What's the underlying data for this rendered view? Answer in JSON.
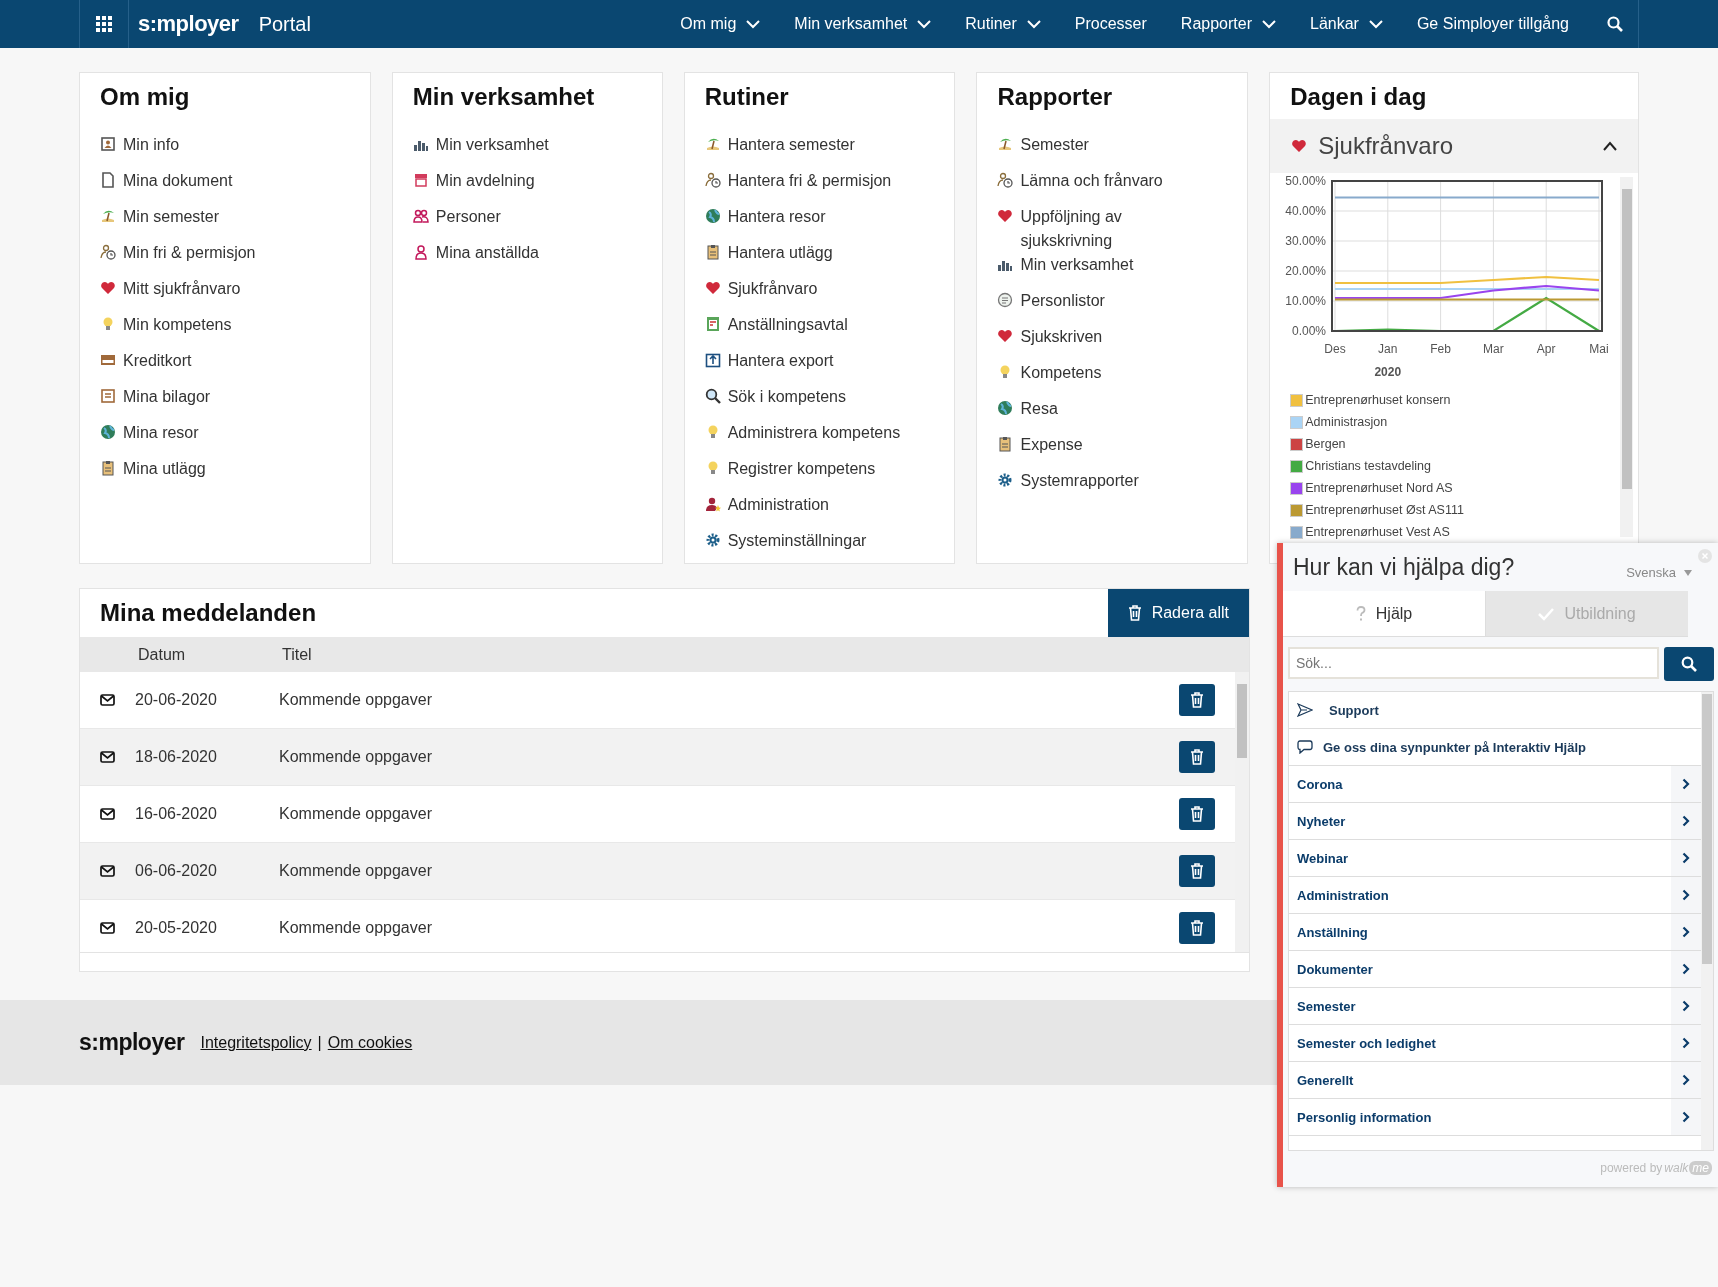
{
  "topbar": {
    "logo": "s:mployer",
    "app": "Portal",
    "menu": [
      {
        "label": "Om mig",
        "dropdown": true
      },
      {
        "label": "Min verksamhet",
        "dropdown": true
      },
      {
        "label": "Rutiner",
        "dropdown": true
      },
      {
        "label": "Processer",
        "dropdown": false
      },
      {
        "label": "Rapporter",
        "dropdown": true
      },
      {
        "label": "Länkar",
        "dropdown": true
      },
      {
        "label": "Ge Simployer tillgång",
        "dropdown": false
      }
    ]
  },
  "cards": [
    {
      "title": "Om mig",
      "items": [
        "Min info",
        "Mina dokument",
        "Min semester",
        "Min fri & permisjon",
        "Mitt sjukfrånvaro",
        "Min kompetens",
        "Kreditkort",
        "Mina bilagor",
        "Mina resor",
        "Mina utlägg"
      ]
    },
    {
      "title": "Min verksamhet",
      "items": [
        "Min verksamhet",
        "Min avdelning",
        "Personer",
        "Mina anställda"
      ]
    },
    {
      "title": "Rutiner",
      "items": [
        "Hantera semester",
        "Hantera fri & permisjon",
        "Hantera resor",
        "Hantera utlägg",
        "Sjukfrånvaro",
        "Anställningsavtal",
        "Hantera export",
        "Sök i kompetens",
        "Administrera kompetens",
        "Registrer kompetens",
        "Administration",
        "Systeminställningar"
      ]
    },
    {
      "title": "Rapporter",
      "items": [
        "Semester",
        "Lämna och frånvaro",
        "Uppföljning av sjukskrivning",
        "Min verksamhet",
        "Personlistor",
        "Sjukskriven",
        "Kompetens",
        "Resa",
        "Expense",
        "Systemrapporter"
      ]
    }
  ],
  "today": {
    "title": "Dagen i dag",
    "section": {
      "label": "Sjukfrånvaro",
      "expanded": true
    },
    "chart_data": {
      "type": "line",
      "grid": true,
      "legend": true,
      "xlabel": "2020",
      "categories": [
        "Des",
        "Jan",
        "Feb",
        "Mar",
        "Apr",
        "Mai"
      ],
      "ylim": [
        0,
        50
      ],
      "yticks": [
        {
          "value": 0,
          "label": "0.00%"
        },
        {
          "value": 10,
          "label": "10.00%"
        },
        {
          "value": 20,
          "label": "20.00%"
        },
        {
          "value": 30,
          "label": "30.00%"
        },
        {
          "value": 40,
          "label": "40.00%"
        },
        {
          "value": 50,
          "label": "50.00%"
        }
      ],
      "series": [
        {
          "name": "Entreprenørhuset konsern",
          "color": "#f0c040",
          "values": [
            16,
            16,
            16,
            17,
            18,
            17
          ]
        },
        {
          "name": "Administrasjon",
          "color": "#aad4f5",
          "values": [
            14,
            14,
            14,
            14,
            14,
            14
          ]
        },
        {
          "name": "Bergen",
          "color": "#cc4444",
          "values": [
            null,
            null,
            null,
            null,
            null,
            null
          ]
        },
        {
          "name": "Christians testavdeling",
          "color": "#44aa44",
          "values": [
            0,
            0.5,
            0,
            0,
            11,
            0
          ]
        },
        {
          "name": "Entreprenørhuset Nord AS",
          "color": "#9944ee",
          "values": [
            11,
            11,
            11,
            13.5,
            15,
            13.5
          ]
        },
        {
          "name": "Entreprenørhuset Øst AS111",
          "color": "#bb9933",
          "values": [
            10.5,
            10.5,
            10.5,
            10.5,
            10.5,
            10.5
          ]
        },
        {
          "name": "Entreprenørhuset Vest AS",
          "color": "#88aacc",
          "values": [
            44.5,
            44.5,
            44.5,
            44.5,
            44.5,
            44.5
          ]
        }
      ]
    }
  },
  "messages": {
    "title": "Mina meddelanden",
    "delete_all": "Radera allt",
    "columns": [
      "Datum",
      "Titel"
    ],
    "rows": [
      {
        "date": "20-06-2020",
        "title": "Kommende oppgaver"
      },
      {
        "date": "18-06-2020",
        "title": "Kommende oppgaver"
      },
      {
        "date": "16-06-2020",
        "title": "Kommende oppgaver"
      },
      {
        "date": "06-06-2020",
        "title": "Kommende oppgaver"
      },
      {
        "date": "20-05-2020",
        "title": "Kommende oppgaver"
      }
    ]
  },
  "footer": {
    "logo": "s:mployer",
    "links": [
      "Integritetspolicy",
      "Om cookies"
    ],
    "separator": "|"
  },
  "help": {
    "title": "Hur kan vi hjälpa dig?",
    "language": "Svenska",
    "tabs": [
      {
        "label": "Hjälp",
        "selected": true
      },
      {
        "label": "Utbildning",
        "selected": false
      }
    ],
    "search": {
      "placeholder": "Sök..."
    },
    "items": [
      {
        "kind": "link",
        "label": "Support"
      },
      {
        "kind": "feedback",
        "label": "Ge oss dina synpunkter på Interaktiv Hjälp"
      },
      {
        "kind": "category",
        "label": "Corona"
      },
      {
        "kind": "category",
        "label": "Nyheter"
      },
      {
        "kind": "category",
        "label": "Webinar"
      },
      {
        "kind": "category",
        "label": "Administration"
      },
      {
        "kind": "category",
        "label": "Anställning"
      },
      {
        "kind": "category",
        "label": "Dokumenter"
      },
      {
        "kind": "category",
        "label": "Semester"
      },
      {
        "kind": "category",
        "label": "Semester och ledighet"
      },
      {
        "kind": "category",
        "label": "Generellt"
      },
      {
        "kind": "category",
        "label": "Personlig information"
      }
    ],
    "powered_by": "powered by",
    "brand": [
      "walk",
      "me"
    ]
  }
}
